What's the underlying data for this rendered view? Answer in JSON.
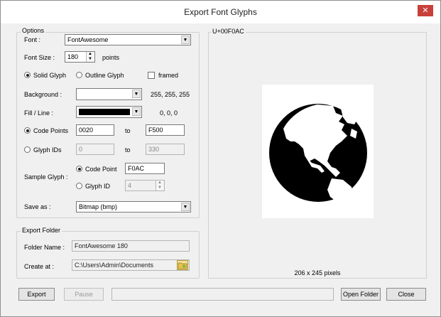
{
  "window": {
    "title": "Export Font Glyphs",
    "close_icon": "close-icon"
  },
  "options": {
    "group_title": "Options",
    "font_label": "Font :",
    "font_value": "FontAwesome",
    "font_size_label": "Font Size :",
    "font_size_value": "180",
    "font_size_unit": "points",
    "solid_glyph_label": "Solid Glyph",
    "outline_glyph_label": "Outline Glyph",
    "framed_label": "framed",
    "glyph_style_selected": "solid",
    "framed_checked": false,
    "background_label": "Background :",
    "background_rgb": "255, 255, 255",
    "background_color": "#ffffff",
    "fill_label": "Fill / Line :",
    "fill_rgb": "0, 0, 0",
    "fill_color": "#000000",
    "code_points_label": "Code Points",
    "code_points_from": "0020",
    "code_points_to": "F500",
    "to_label": "to",
    "glyph_ids_label": "Glyph IDs",
    "glyph_ids_from": "0",
    "glyph_ids_to": "330",
    "range_mode_selected": "code_points",
    "sample_glyph_label": "Sample Glyph :",
    "sample_code_point_label": "Code Point",
    "sample_code_point_value": "F0AC",
    "sample_glyph_id_label": "Glyph ID",
    "sample_glyph_id_value": "4",
    "sample_mode_selected": "code_point",
    "save_as_label": "Save as :",
    "save_as_value": "Bitmap (bmp)"
  },
  "export_folder": {
    "group_title": "Export Folder",
    "folder_name_label": "Folder Name :",
    "folder_name_value": "FontAwesome 180",
    "create_at_label": "Create at :",
    "create_at_value": "C:\\Users\\Admin\\Documents",
    "browse_icon": "folder-browse-icon"
  },
  "preview": {
    "code_label": "U+00F0AC",
    "size_label": "206 x 245 pixels",
    "glyph_icon": "globe-americas-icon"
  },
  "buttons": {
    "export": "Export",
    "pause": "Pause",
    "open_folder": "Open Folder",
    "close": "Close"
  }
}
